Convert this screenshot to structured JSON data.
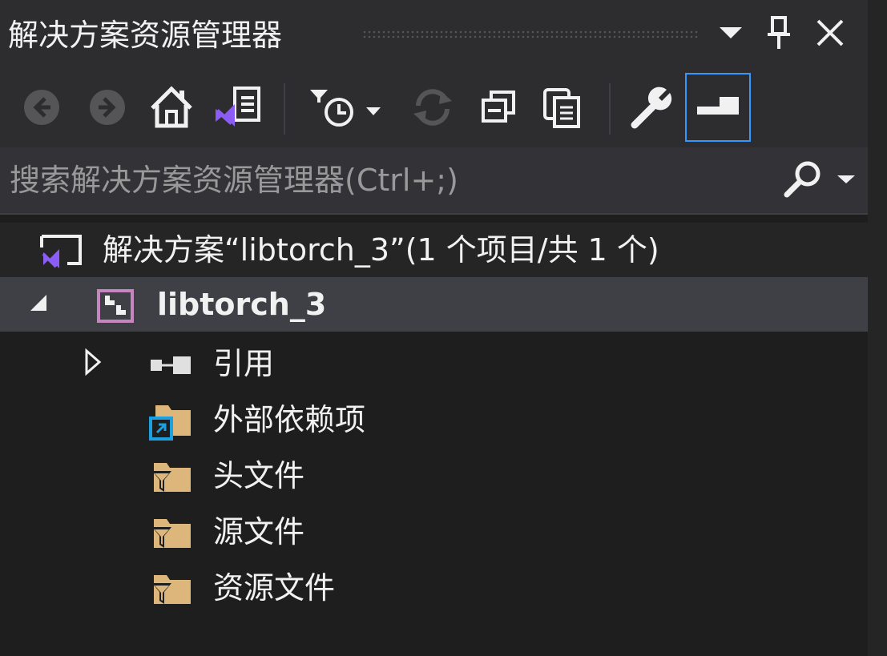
{
  "window": {
    "title": "解决方案资源管理器",
    "pin_icon": "pin-icon",
    "close_icon": "close-icon",
    "dropdown_icon": "window-menu-icon"
  },
  "toolbar": {
    "buttons": [
      {
        "name": "back-button",
        "icon": "arrow-left-icon"
      },
      {
        "name": "forward-button",
        "icon": "arrow-right-icon"
      },
      {
        "name": "home-button",
        "icon": "home-icon"
      },
      {
        "name": "switch-views-button",
        "icon": "vs-solution-view-icon"
      },
      {
        "name": "pending-changes-filter-button",
        "icon": "clock-filter-icon"
      },
      {
        "name": "sync-button",
        "icon": "refresh-icon"
      },
      {
        "name": "collapse-all-button",
        "icon": "collapse-all-icon"
      },
      {
        "name": "show-all-files-button",
        "icon": "show-all-files-icon"
      },
      {
        "name": "properties-button",
        "icon": "wrench-icon"
      },
      {
        "name": "preview-selected-button",
        "icon": "preview-icon"
      }
    ]
  },
  "search": {
    "placeholder": "搜索解决方案资源管理器(Ctrl+;)",
    "search_icon": "search-icon",
    "options_icon": "chevron-down-icon"
  },
  "tree": {
    "solution_label": "解决方案“libtorch_3”(1 个项目/共 1 个)",
    "project_label": "libtorch_3",
    "items": [
      {
        "label": "引用",
        "icon": "references-icon",
        "expandable": true
      },
      {
        "label": "外部依赖项",
        "icon": "external-dependencies-icon",
        "expandable": false
      },
      {
        "label": "头文件",
        "icon": "filter-folder-icon",
        "expandable": false
      },
      {
        "label": "源文件",
        "icon": "filter-folder-icon",
        "expandable": false
      },
      {
        "label": "资源文件",
        "icon": "filter-folder-icon",
        "expandable": false
      }
    ]
  },
  "colors": {
    "background": "#1e1e1e",
    "toolbar": "#2d2d30",
    "selected_row": "#3f3f46",
    "solution_row": "#252526",
    "accent": "#3399ff",
    "vs_purple": "#8b5cf6",
    "folder": "#dcb67a"
  }
}
